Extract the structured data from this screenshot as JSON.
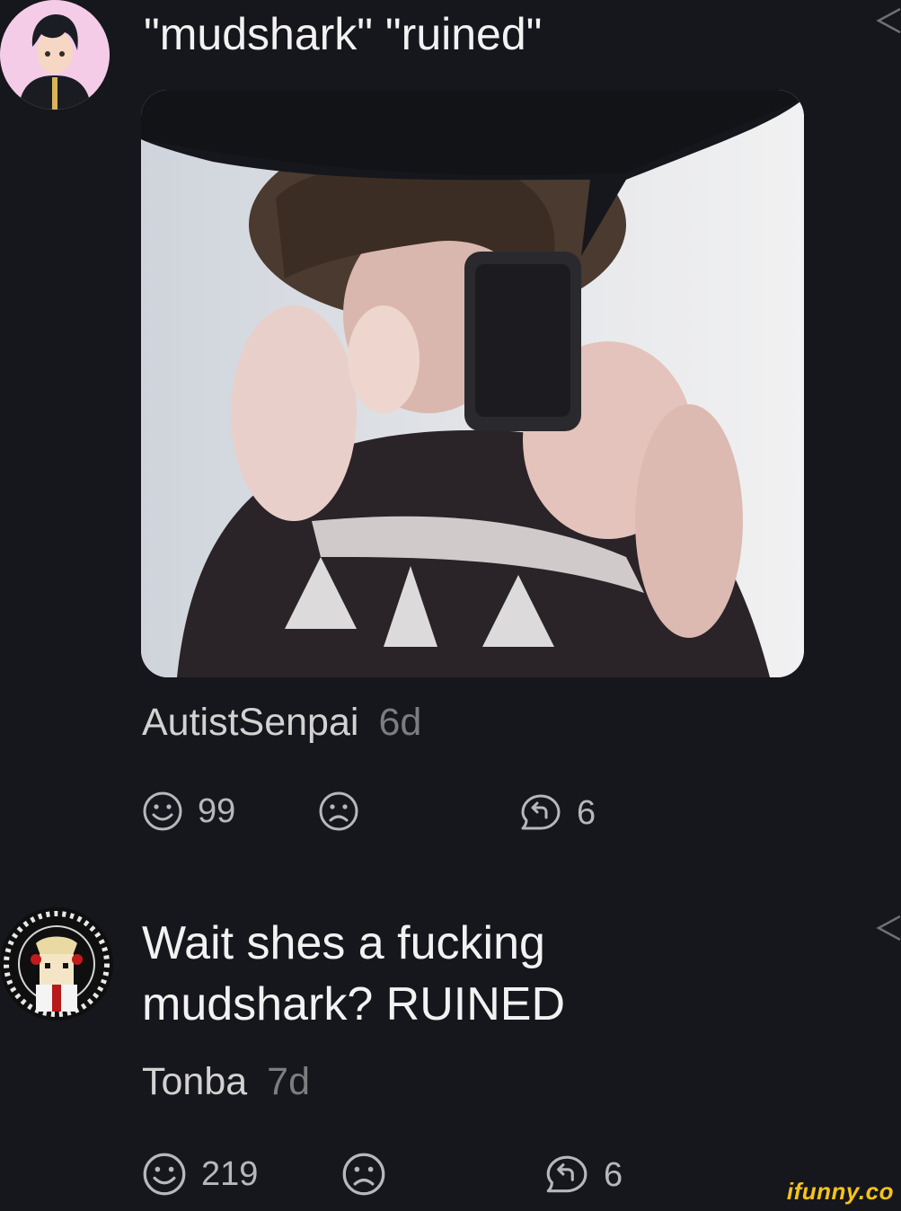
{
  "comments": [
    {
      "text": "\"mudshark\" \"ruined\"",
      "author": "AutistSenpai",
      "time": "6d",
      "likes": "99",
      "replies": "6"
    },
    {
      "text": "Wait shes a fucking mudshark? RUINED",
      "author": "Tonba",
      "time": "7d",
      "likes": "219",
      "replies": "6"
    }
  ],
  "watermark": "ifunny.co",
  "colors": {
    "background": "#16171c",
    "text": "#f2f2f2",
    "meta": "#7d7d80",
    "icon": "#b8b8bb",
    "brand": "#f7c31a"
  },
  "icons": {
    "like": "smile-icon",
    "dislike": "frown-icon",
    "reply": "reply-bubble-icon",
    "share": "share-icon"
  }
}
